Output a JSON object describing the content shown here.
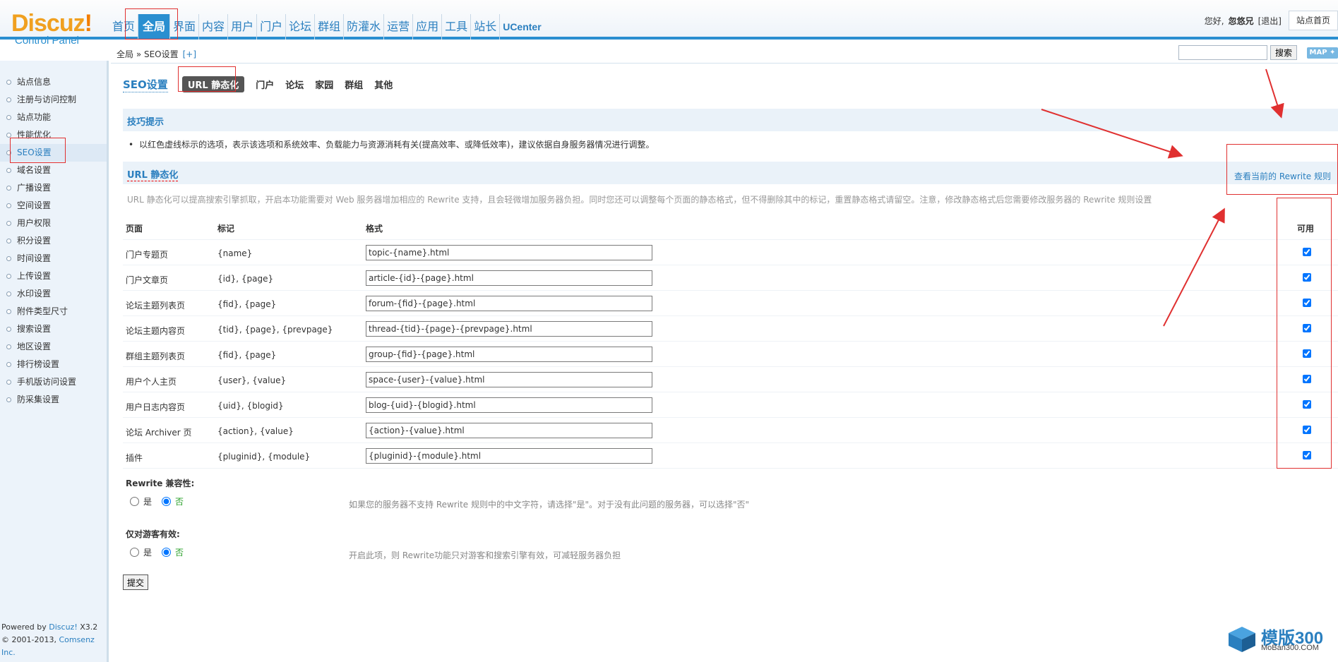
{
  "header": {
    "logo_main": "Discuz",
    "logo_bang": "!",
    "logo_sub": "Control Panel",
    "nav": [
      "首页",
      "全局",
      "界面",
      "内容",
      "用户",
      "门户",
      "论坛",
      "群组",
      "防灌水",
      "运营",
      "应用",
      "工具",
      "站长",
      "UCenter"
    ],
    "active_nav": "全局",
    "greeting": "您好,",
    "username": "忽悠兄",
    "logout": "[退出]",
    "home": "站点首页"
  },
  "breadcrumb": {
    "path": "全局 » SEO设置",
    "plus": "[+]"
  },
  "search": {
    "value": "",
    "button": "搜索",
    "map": "MAP ✦"
  },
  "sidebar": {
    "items": [
      "站点信息",
      "注册与访问控制",
      "站点功能",
      "性能优化",
      "SEO设置",
      "域名设置",
      "广播设置",
      "空间设置",
      "用户权限",
      "积分设置",
      "时间设置",
      "上传设置",
      "水印设置",
      "附件类型尺寸",
      "搜索设置",
      "地区设置",
      "排行榜设置",
      "手机版访问设置",
      "防采集设置"
    ],
    "active": "SEO设置",
    "footer_powered": "Powered by ",
    "footer_discuz": "Discuz!",
    "footer_version": " X3.2",
    "footer_copy": "© 2001-2013, ",
    "footer_comsenz": "Comsenz Inc."
  },
  "tabs": {
    "title": "SEO设置",
    "items": [
      "URL 静态化",
      "门户",
      "论坛",
      "家园",
      "群组",
      "其他"
    ],
    "active": "URL 静态化"
  },
  "tips": {
    "title": "技巧提示",
    "line": "以红色虚线标示的选项，表示该选项和系统效率、负载能力与资源消耗有关(提高效率、或降低效率)，建议依据自身服务器情况进行调整。"
  },
  "url_section": {
    "title": "URL 静态化",
    "rewrite_link": "查看当前的 Rewrite 规则",
    "description": "URL 静态化可以提高搜索引擎抓取，开启本功能需要对 Web 服务器增加相应的 Rewrite 支持，且会轻微增加服务器负担。同时您还可以调整每个页面的静态格式，但不得删除其中的标记，重置静态格式请留空。注意，修改静态格式后您需要修改服务器的 Rewrite 规则设置"
  },
  "table": {
    "headers": [
      "页面",
      "标记",
      "格式",
      "可用"
    ],
    "rows": [
      {
        "page": "门户专题页",
        "marker": "{name}",
        "format": "topic-{name}.html",
        "enabled": true
      },
      {
        "page": "门户文章页",
        "marker": "{id}, {page}",
        "format": "article-{id}-{page}.html",
        "enabled": true
      },
      {
        "page": "论坛主题列表页",
        "marker": "{fid}, {page}",
        "format": "forum-{fid}-{page}.html",
        "enabled": true
      },
      {
        "page": "论坛主题内容页",
        "marker": "{tid}, {page}, {prevpage}",
        "format": "thread-{tid}-{page}-{prevpage}.html",
        "enabled": true
      },
      {
        "page": "群组主题列表页",
        "marker": "{fid}, {page}",
        "format": "group-{fid}-{page}.html",
        "enabled": true
      },
      {
        "page": "用户个人主页",
        "marker": "{user}, {value}",
        "format": "space-{user}-{value}.html",
        "enabled": true
      },
      {
        "page": "用户日志内容页",
        "marker": "{uid}, {blogid}",
        "format": "blog-{uid}-{blogid}.html",
        "enabled": true
      },
      {
        "page": "论坛 Archiver 页",
        "marker": "{action}, {value}",
        "format": "{action}-{value}.html",
        "enabled": true
      },
      {
        "page": "插件",
        "marker": "{pluginid}, {module}",
        "format": "{pluginid}-{module}.html",
        "enabled": true
      }
    ]
  },
  "options": [
    {
      "label": "Rewrite 兼容性:",
      "yes": "是",
      "no": "否",
      "selected": "否",
      "note": "如果您的服务器不支持 Rewrite 规则中的中文字符，请选择\"是\"。对于没有此问题的服务器，可以选择\"否\""
    },
    {
      "label": "仅对游客有效:",
      "yes": "是",
      "no": "否",
      "selected": "否",
      "note": "开启此项，则 Rewrite功能只对游客和搜索引擎有效，可减轻服务器负担"
    }
  ],
  "submit": "提交",
  "watermark": {
    "main": "模版300",
    "sub": "MoBan300.COM"
  },
  "colors": {
    "accent": "#2a8fd0",
    "link": "#2a7fbf",
    "annotation": "#e03030"
  }
}
